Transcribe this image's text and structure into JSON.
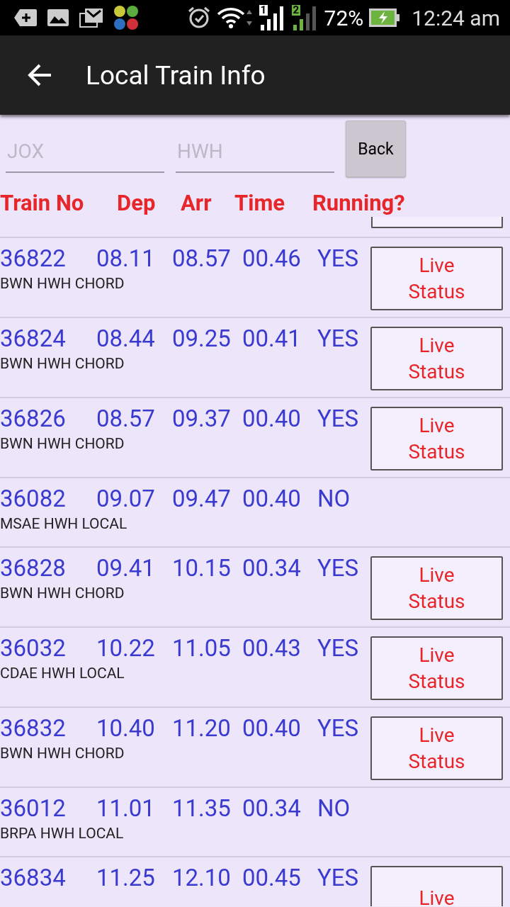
{
  "status_bar": {
    "sims": [
      "1",
      "2"
    ],
    "battery": "72%",
    "time": "12:24 am"
  },
  "app_bar": {
    "title": "Local Train Info"
  },
  "form": {
    "from": {
      "placeholder": "JOX"
    },
    "to": {
      "placeholder": "HWH"
    },
    "button": "Back"
  },
  "table": {
    "columns": [
      "Train No",
      "Dep",
      "Arr",
      "Time",
      "Running?"
    ],
    "rows": [
      {
        "train_no": "36822",
        "dep": "08.11",
        "arr": "08.57",
        "time": "00.46",
        "running": "YES",
        "name": "BWN HWH CHORD",
        "button": "Live Status"
      },
      {
        "train_no": "36824",
        "dep": "08.44",
        "arr": "09.25",
        "time": "00.41",
        "running": "YES",
        "name": "BWN HWH CHORD",
        "button": "Live Status"
      },
      {
        "train_no": "36826",
        "dep": "08.57",
        "arr": "09.37",
        "time": "00.40",
        "running": "YES",
        "name": "BWN HWH CHORD",
        "button": "Live Status"
      },
      {
        "train_no": "36082",
        "dep": "09.07",
        "arr": "09.47",
        "time": "00.40",
        "running": "NO",
        "name": "MSAE HWH LOCAL"
      },
      {
        "train_no": "36828",
        "dep": "09.41",
        "arr": "10.15",
        "time": "00.34",
        "running": "YES",
        "name": "BWN HWH CHORD",
        "button": "Live Status"
      },
      {
        "train_no": "36032",
        "dep": "10.22",
        "arr": "11.05",
        "time": "00.43",
        "running": "YES",
        "name": "CDAE HWH LOCAL",
        "button": "Live Status"
      },
      {
        "train_no": "36832",
        "dep": "10.40",
        "arr": "11.20",
        "time": "00.40",
        "running": "YES",
        "name": "BWN HWH CHORD",
        "button": "Live Status"
      },
      {
        "train_no": "36012",
        "dep": "11.01",
        "arr": "11.35",
        "time": "00.34",
        "running": "NO",
        "name": "BRPA HWH LOCAL"
      },
      {
        "train_no": "36834",
        "dep": "11.25",
        "arr": "12.10",
        "time": "00.45",
        "running": "YES",
        "button": "Live"
      }
    ]
  }
}
